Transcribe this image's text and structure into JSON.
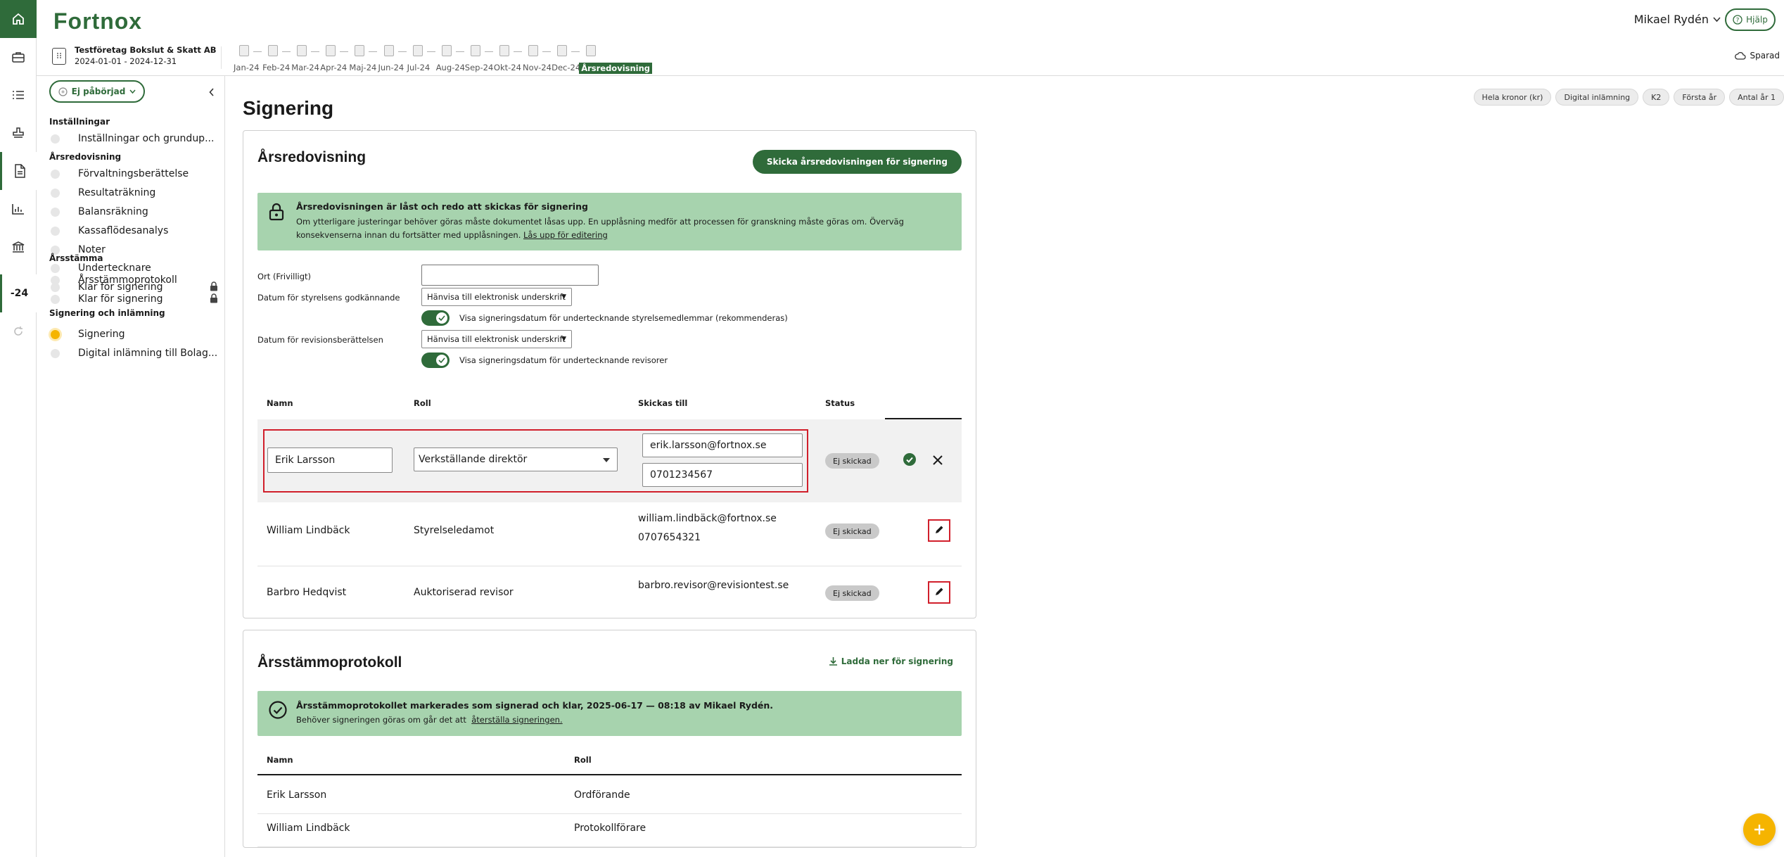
{
  "app": {
    "logo": "Fortnox",
    "user": "Mikael Rydén",
    "help": "Hjälp",
    "saved": "Sparad",
    "rail_number": "-24"
  },
  "company": {
    "name": "Testföretag Bokslut & Skatt AB",
    "dates": "2024-01-01 - 2024-12-31"
  },
  "periods": [
    "Jan-24",
    "Feb-24",
    "Mar-24",
    "Apr-24",
    "Maj-24",
    "Jun-24",
    "Jul-24",
    "Aug-24",
    "Sep-24",
    "Okt-24",
    "Nov-24",
    "Dec-24",
    "Årsredovisning"
  ],
  "sidebar": {
    "status": "Ej påbörjad",
    "sections": [
      {
        "title": "Inställningar",
        "items": [
          "Inställningar och grundup..."
        ]
      },
      {
        "title": "Årsredovisning",
        "items": [
          "Förvaltningsberättelse",
          "Resultaträkning",
          "Balansräkning",
          "Kassaflödesanalys",
          "Noter",
          "Undertecknare",
          "Klar för signering"
        ]
      },
      {
        "title": "Årsstämma",
        "items": [
          "Årsstämmoprotokoll",
          "Klar för signering"
        ]
      },
      {
        "title": "Signering och inlämning",
        "items": [
          "Signering",
          "Digital inlämning till Bolag..."
        ]
      }
    ]
  },
  "page": {
    "title": "Signering",
    "tags": [
      "Hela kronor (kr)",
      "Digital inlämning",
      "K2",
      "Första år",
      "Antal år 1"
    ]
  },
  "arsredovisning": {
    "title": "Årsredovisning",
    "send_button": "Skicka årsredovisningen för signering",
    "banner_title": "Årsredovisningen är låst och redo att skickas för signering",
    "banner_text": "Om ytterligare justeringar behöver göras måste dokumentet låsas upp. En upplåsning medför att processen för granskning måste göras om. Överväg konsekvenserna innan du fortsätter med upplåsningen.",
    "banner_link": "Lås upp för editering",
    "ort_label": "Ort (Frivilligt)",
    "ort_value": "",
    "board_date_label": "Datum för styrelsens godkännande",
    "board_date_value": "Hänvisa till elektronisk underskrift",
    "board_toggle_label": "Visa signeringsdatum för undertecknande styrelsemedlemmar (rekommenderas)",
    "audit_date_label": "Datum för revisionsberättelsen",
    "audit_date_value": "Hänvisa till elektronisk underskrift",
    "audit_toggle_label": "Visa signeringsdatum för undertecknande revisorer",
    "columns": {
      "name": "Namn",
      "role": "Roll",
      "send_to": "Skickas till",
      "status": "Status"
    },
    "edit_row": {
      "name": "Erik Larsson",
      "role": "Verkställande direktör",
      "email": "erik.larsson@fortnox.se",
      "phone": "0701234567",
      "status": "Ej skickad"
    },
    "rows": [
      {
        "name": "William Lindbäck",
        "role": "Styrelseledamot",
        "email": "william.lindbäck@fortnox.se",
        "phone": "0707654321",
        "status": "Ej skickad"
      },
      {
        "name": "Barbro Hedqvist",
        "role": "Auktoriserad revisor",
        "email": "barbro.revisor@revisiontest.se",
        "phone": "",
        "status": "Ej skickad"
      }
    ]
  },
  "protokoll": {
    "title": "Årsstämmoprotokoll",
    "download": "Ladda ner för signering",
    "banner_title": "Årsstämmoprotokollet markerades som signerad och klar, 2025-06-17 — 08:18 av Mikael Rydén.",
    "banner_text": "Behöver signeringen göras om går det att",
    "banner_link": "återställa signeringen.",
    "columns": {
      "name": "Namn",
      "role": "Roll"
    },
    "rows": [
      {
        "name": "Erik Larsson",
        "role": "Ordförande"
      },
      {
        "name": "William Lindbäck",
        "role": "Protokollförare"
      }
    ]
  },
  "colors": {
    "brand": "#2f6b3a",
    "banner": "#a7d3ae",
    "highlight": "#d11f2b",
    "active_dot": "#f5b400"
  }
}
